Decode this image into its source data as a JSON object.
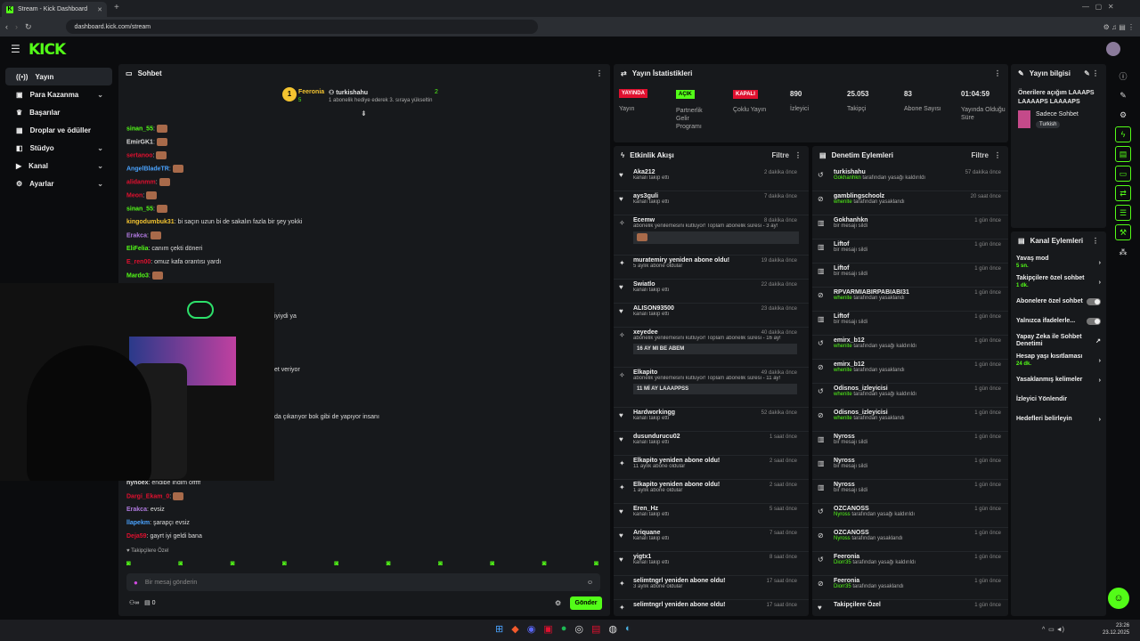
{
  "browser": {
    "tab_title": "Stream - Kick Dashboard",
    "url": "dashboard.kick.com/stream"
  },
  "app": {
    "logo": "KICK"
  },
  "sidebar": {
    "items": [
      {
        "label": "Yayın"
      },
      {
        "label": "Para Kazanma"
      },
      {
        "label": "Başarılar"
      },
      {
        "label": "Droplar ve ödüller"
      },
      {
        "label": "Stüdyo"
      },
      {
        "label": "Kanal"
      },
      {
        "label": "Ayarlar"
      }
    ]
  },
  "chat": {
    "title": "Sohbet",
    "top_gifter": "Feeronia",
    "top_gifter_count": "5",
    "streamer": "turkishahu",
    "streamer_count": "2",
    "gift_note": "1 abonelik hediye ederek 3. sıraya yükseltin",
    "lines": [
      {
        "user": "sinan_55",
        "text": ""
      },
      {
        "user": "EmirGK1",
        "text": ""
      },
      {
        "user": "sertanoo",
        "text": ""
      },
      {
        "user": "AngelBladeTR",
        "text": ""
      },
      {
        "user": "alidanmm",
        "text": ""
      },
      {
        "user": "Meon",
        "text": ""
      },
      {
        "user": "sinan_55",
        "text": ""
      },
      {
        "user": "kingodumbuk31",
        "text": "bi saçın uzun bi de sakalın fazla bir şey yokki"
      },
      {
        "user": "Erakca",
        "text": ""
      },
      {
        "user": "EliFelia",
        "text": "canım çekti döneri"
      },
      {
        "user": "E_ren00",
        "text": "omuz kafa orantısı yardı"
      },
      {
        "user": "Mardo3",
        "text": ""
      }
    ],
    "partial": [
      {
        "text": "iyiydi ya"
      },
      {
        "text": "et veriyor"
      },
      {
        "text": "da çıkarıyor bok gibi de yapıyor insanı"
      }
    ],
    "lines2": [
      {
        "user": "hynoex",
        "text": "endibe indim offfff"
      },
      {
        "user": "Dargi_Ekam_0",
        "text": ""
      },
      {
        "user": "Erakca",
        "text": "evsiz"
      },
      {
        "user": "llapekm",
        "text": "şarapçı evsiz"
      },
      {
        "user": "Deja59",
        "text": "gayrt iyi geldi bana"
      }
    ],
    "follower_only": "Takipçilere Özel",
    "input_placeholder": "Bir mesaj gönderin",
    "send": "Gönder",
    "viewer_count": "0"
  },
  "stats": {
    "title": "Yayın İstatistikleri",
    "items": [
      {
        "badge": "YAYINDA",
        "label": "Yayın"
      },
      {
        "badge": "AÇIK",
        "label": "Partnerlik Gelir Programı"
      },
      {
        "badge": "KAPALI",
        "label": "Çoklu Yayın"
      },
      {
        "value": "890",
        "label": "İzleyici"
      },
      {
        "value": "25.053",
        "label": "Takipçi"
      },
      {
        "value": "83",
        "label": "Abone Sayısı"
      },
      {
        "value": "01:04:59",
        "label": "Yayında Olduğu Süre"
      }
    ]
  },
  "activity": {
    "title": "Etkinlik Akışı",
    "filter": "Filtre",
    "items": [
      {
        "name": "Aka212",
        "sub": "kanalı takip etti",
        "time": "2 dakika önce"
      },
      {
        "name": "ays3guli",
        "sub": "kanalı takip etti",
        "time": "7 dakika önce"
      },
      {
        "name": "Ecemw",
        "sub": "abonelik yenilemesini kutluyor! Toplam abonelik süresi - 3 ay!",
        "time": "8 dakika önce"
      },
      {
        "name": "muratemiry yeniden abone oldu!",
        "sub": "5 aylık abone oldular",
        "time": "19 dakika önce"
      },
      {
        "name": "Swiatlo",
        "sub": "kanalı takip etti",
        "time": "22 dakika önce"
      },
      {
        "name": "ALISON93500",
        "sub": "kanalı takip etti",
        "time": "23 dakika önce"
      },
      {
        "name": "xeyedee",
        "sub": "abonelik yenilemesini kutluyor! Toplam abonelik süresi - 16 ay!",
        "msg": "16 AY MI BE ABEM",
        "time": "40 dakika önce"
      },
      {
        "name": "Elkapito",
        "sub": "abonelik yenilemesini kutluyor! Toplam abonelik süresi - 11 ay!",
        "msg": "11 Mİ AY LAAAPPSS",
        "time": "49 dakika önce"
      },
      {
        "name": "Hardworkingg",
        "sub": "kanalı takip etti",
        "time": "52 dakika önce"
      },
      {
        "name": "dusundurucu02",
        "sub": "kanalı takip etti",
        "time": "1 saat önce"
      },
      {
        "name": "Elkapito yeniden abone oldu!",
        "sub": "11 aylık abone oldular",
        "time": "2 saat önce"
      },
      {
        "name": "Elkapito yeniden abone oldu!",
        "sub": "1 aylık abone oldular",
        "time": "2 saat önce"
      },
      {
        "name": "Eren_Hz",
        "sub": "kanalı takip etti",
        "time": "5 saat önce"
      },
      {
        "name": "Ariquane",
        "sub": "kanalı takip etti",
        "time": "7 saat önce"
      },
      {
        "name": "yigtx1",
        "sub": "kanalı takip etti",
        "time": "8 saat önce"
      },
      {
        "name": "selimtngrl yeniden abone oldu!",
        "sub": "3 aylık abone oldular",
        "time": "17 saat önce"
      },
      {
        "name": "selimtngrl yeniden abone oldu!",
        "sub": "",
        "time": "17 saat önce"
      }
    ]
  },
  "moderation": {
    "title": "Denetim Eylemleri",
    "filter": "Filtre",
    "items": [
      {
        "name": "turkishahu",
        "sub": "Gokhanhkn tarafından yasağı kaldırıldı",
        "time": "57 dakika önce"
      },
      {
        "name": "gamblingschoolz",
        "sub": "whenite tarafından yasaklandı",
        "time": "20 saat önce"
      },
      {
        "name": "Gokhanhkn",
        "sub": "bir mesajı sildi",
        "time": "1 gün önce"
      },
      {
        "name": "Liftof",
        "sub": "bir mesajı sildi",
        "time": "1 gün önce"
      },
      {
        "name": "Liftof",
        "sub": "bir mesajı sildi",
        "time": "1 gün önce"
      },
      {
        "name": "RPVARMIABIRPABIABI31",
        "sub": "whenite tarafından yasaklandı",
        "time": "1 gün önce"
      },
      {
        "name": "Liftof",
        "sub": "bir mesajı sildi",
        "time": "1 gün önce"
      },
      {
        "name": "emirx_b12",
        "sub": "whenite tarafından yasağı kaldırıldı",
        "time": "1 gün önce"
      },
      {
        "name": "emirx_b12",
        "sub": "whenite tarafından yasaklandı",
        "time": "1 gün önce"
      },
      {
        "name": "Odisnos_izleyicisi",
        "sub": "whenite tarafından yasağı kaldırıldı",
        "time": "1 gün önce"
      },
      {
        "name": "Odisnos_izleyicisi",
        "sub": "whenite tarafından yasaklandı",
        "time": "1 gün önce"
      },
      {
        "name": "Nyross",
        "sub": "bir mesajı sildi",
        "time": "1 gün önce"
      },
      {
        "name": "Nyross",
        "sub": "bir mesajı sildi",
        "time": "1 gün önce"
      },
      {
        "name": "Nyross",
        "sub": "bir mesajı sildi",
        "time": "1 gün önce"
      },
      {
        "name": "OZCANOSS",
        "sub": "Nyross tarafından yasağı kaldırıldı",
        "time": "1 gün önce"
      },
      {
        "name": "OZCANOSS",
        "sub": "Nyross tarafından yasaklandı",
        "time": "1 gün önce"
      },
      {
        "name": "Feeronia",
        "sub": "Diorr35 tarafından yasağı kaldırıldı",
        "time": "1 gün önce"
      },
      {
        "name": "Feeronia",
        "sub": "Diorr35 tarafından yasaklandı",
        "time": "1 gün önce"
      },
      {
        "name": "Takipçilere Özel",
        "sub": "",
        "time": "1 gün önce"
      }
    ]
  },
  "info": {
    "title": "Yayın bilgisi",
    "stream_title": "Önerilere açığım LAAAPS LAAAAPS LAAAAPS",
    "category": "Sadece Sohbet",
    "tag": "Turkish"
  },
  "channel_actions": {
    "title": "Kanal Eylemleri",
    "items": [
      {
        "label": "Yavaş mod",
        "sub": "5 sn."
      },
      {
        "label": "Takipçilere özel sohbet",
        "sub": "1 dk."
      },
      {
        "label": "Abonelere özel sohbet",
        "sub": ""
      },
      {
        "label": "Yalnızca ifadelerle...",
        "sub": ""
      },
      {
        "label": "Yapay Zeka ile Sohbet Denetimi",
        "sub": ""
      },
      {
        "label": "Hesap yaşı kısıtlaması",
        "sub": "24 dk."
      },
      {
        "label": "Yasaklanmış kelimeler",
        "sub": ""
      },
      {
        "label": "İzleyici Yönlendir",
        "sub": ""
      },
      {
        "label": "Hedefleri belirleyin",
        "sub": ""
      }
    ]
  },
  "taskbar": {
    "time": "23:26",
    "date": "23.12.2025"
  },
  "colors": {
    "accent": "#53fc18",
    "live": "#e0102f"
  }
}
